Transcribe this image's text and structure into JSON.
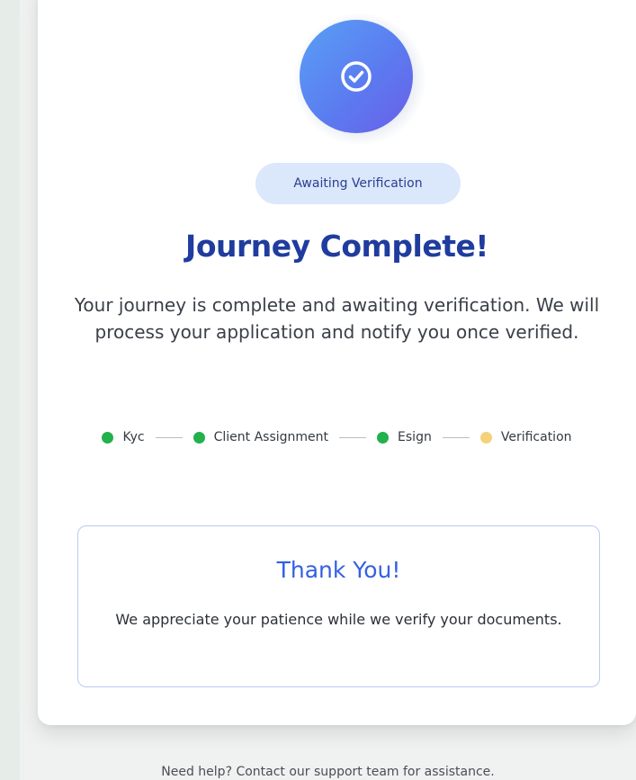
{
  "status": {
    "badge": "Awaiting Verification"
  },
  "header": {
    "title": "Journey Complete!",
    "description": "Your journey is complete and awaiting verification. We will process your application and notify you once verified."
  },
  "steps": [
    {
      "label": "Kyc",
      "state": "complete",
      "color": "#22b14c"
    },
    {
      "label": "Client Assignment",
      "state": "complete",
      "color": "#22b14c"
    },
    {
      "label": "Esign",
      "state": "complete",
      "color": "#22b14c"
    },
    {
      "label": "Verification",
      "state": "pending",
      "color": "#f4d27a"
    }
  ],
  "thanks": {
    "title": "Thank You!",
    "message": "We appreciate your patience while we verify your documents."
  },
  "footer": {
    "help_text": "Need help? Contact our support team for assistance."
  },
  "icons": {
    "status_icon": "check-circle-icon"
  },
  "colors": {
    "accent": "#3560e4",
    "title": "#1f3c9e",
    "badge_bg": "#dbe7fb",
    "complete": "#22b14c",
    "pending": "#f4d27a"
  }
}
